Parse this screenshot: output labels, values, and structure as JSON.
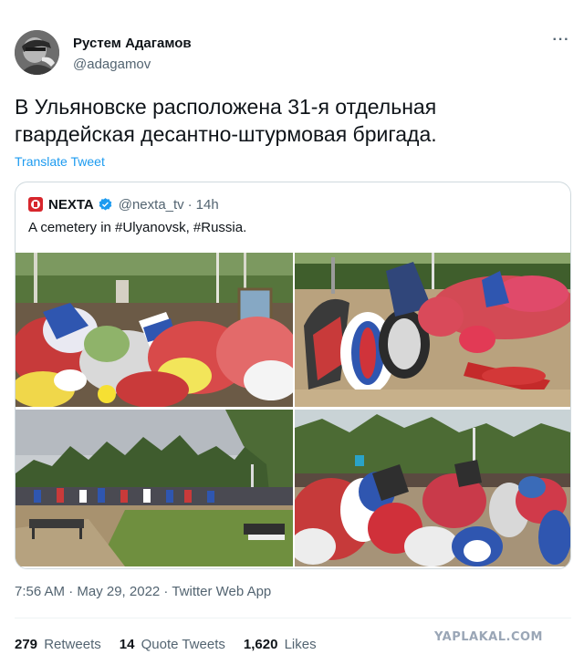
{
  "author": {
    "name": "Рустем Адагамов",
    "handle": "@adagamov"
  },
  "tweet": {
    "text": "В Ульяновске расположена 31-я отдельная гвардейская десантно-штурмовая бригада.",
    "translate_label": "Translate Tweet"
  },
  "quoted": {
    "name": "NEXTA",
    "handle": "@nexta_tv",
    "separator": "·",
    "time": "14h",
    "text": "A cemetery in #Ulyanovsk, #Russia.",
    "logo_color": "#d7262c",
    "verified_color": "#1d9bf0"
  },
  "meta": {
    "text": "7:56 AM · May 29, 2022 · Twitter Web App"
  },
  "stats": {
    "retweets_count": "279",
    "retweets_label": "Retweets",
    "quotes_count": "14",
    "quotes_label": "Quote Tweets",
    "likes_count": "1,620",
    "likes_label": "Likes"
  },
  "watermark": "YAPLAKAL.COM",
  "colors": {
    "link": "#1d9bf0",
    "secondary_text": "#536471",
    "primary_text": "#0f1419",
    "border": "#cfd9de"
  }
}
